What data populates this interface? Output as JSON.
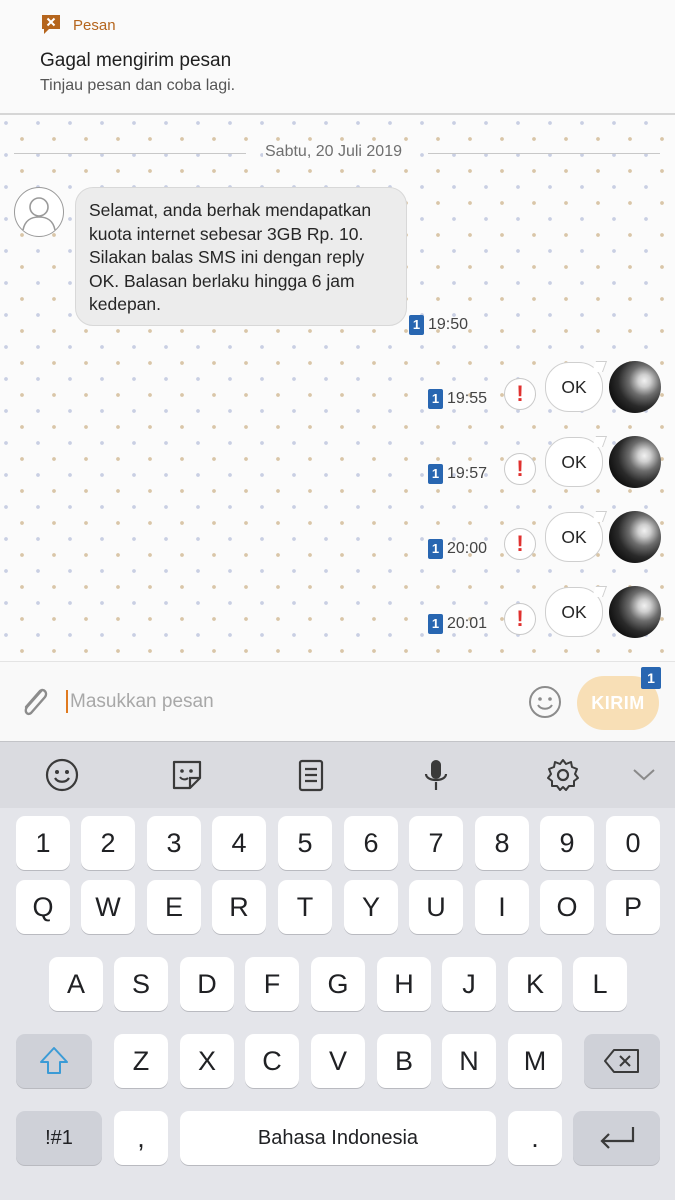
{
  "notification": {
    "app_name": "Pesan",
    "title": "Gagal mengirim pesan",
    "subtitle": "Tinjau pesan dan coba lagi."
  },
  "conversation": {
    "date_separator": "Sabtu, 20 Juli 2019",
    "incoming": {
      "text": "Selamat, anda berhak mendapatkan kuota internet sebesar 3GB Rp. 10. Silakan balas SMS ini dengan reply OK. Balasan berlaku hingga 6 jam kedepan.",
      "sim": "1",
      "time": "19:50"
    },
    "outgoing": [
      {
        "text": "OK",
        "sim": "1",
        "time": "19:55",
        "status_icon": "error-exclamation"
      },
      {
        "text": "OK",
        "sim": "1",
        "time": "19:57",
        "status_icon": "error-exclamation"
      },
      {
        "text": "OK",
        "sim": "1",
        "time": "20:00",
        "status_icon": "error-exclamation"
      },
      {
        "text": "OK",
        "sim": "1",
        "time": "20:01",
        "status_icon": "error-exclamation"
      }
    ]
  },
  "composer": {
    "placeholder": "Masukkan pesan",
    "send_label": "KIRIM",
    "send_sim": "1"
  },
  "keyboard": {
    "toolbar": [
      "emoji-icon",
      "sticker-icon",
      "clipboard-icon",
      "microphone-icon",
      "settings-icon",
      "chevron-down-icon"
    ],
    "row_numbers": [
      "1",
      "2",
      "3",
      "4",
      "5",
      "6",
      "7",
      "8",
      "9",
      "0"
    ],
    "row_top": [
      "Q",
      "W",
      "E",
      "R",
      "T",
      "Y",
      "U",
      "I",
      "O",
      "P"
    ],
    "row_middle": [
      "A",
      "S",
      "D",
      "F",
      "G",
      "H",
      "J",
      "K",
      "L"
    ],
    "row_bottom": [
      "Z",
      "X",
      "C",
      "V",
      "B",
      "N",
      "M"
    ],
    "symbols_label": "!#1",
    "comma_label": ",",
    "space_label": "Bahasa Indonesia",
    "period_label": "."
  },
  "colors": {
    "accent_orange": "#b5651d",
    "send_button": "#f8dfb6",
    "sim_badge": "#2866b1",
    "error_red": "#e0312f"
  }
}
